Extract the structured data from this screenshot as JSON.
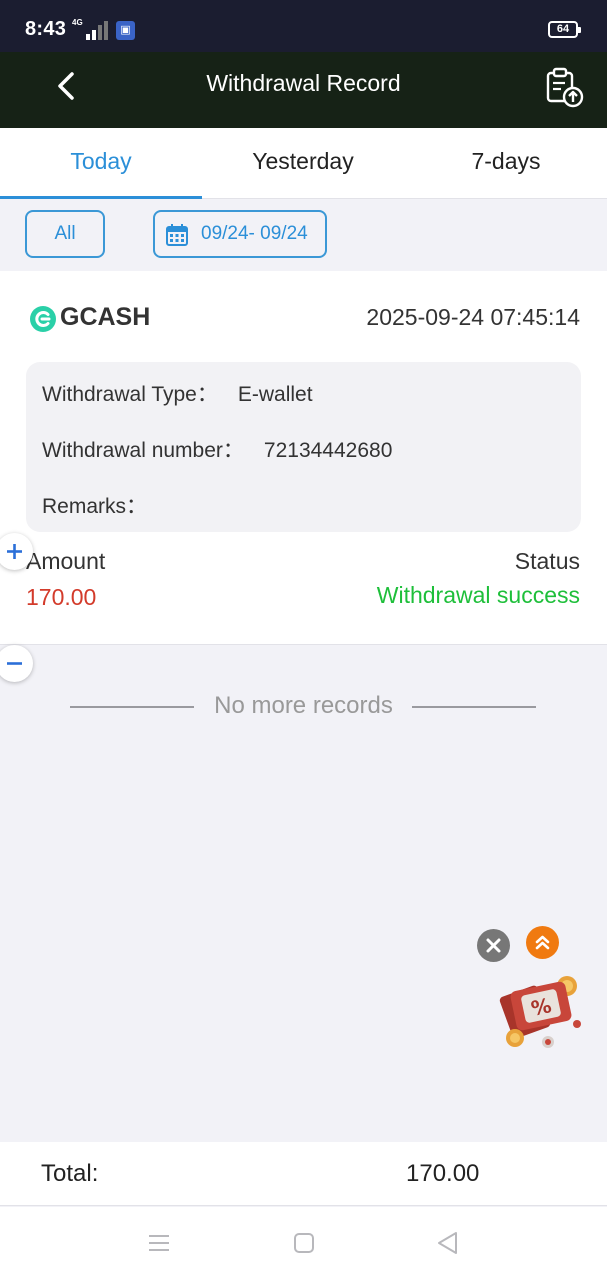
{
  "status_bar": {
    "time": "8:43",
    "network": "4G",
    "battery": "64"
  },
  "header": {
    "title": "Withdrawal Record",
    "back_icon": "chevron-left-icon",
    "export_icon": "clipboard-upload-icon"
  },
  "tabs": [
    {
      "label": "Today",
      "active": true
    },
    {
      "label": "Yesterday",
      "active": false
    },
    {
      "label": "7-days",
      "active": false
    }
  ],
  "filters": {
    "all_label": "All",
    "date_range": "09/24- 09/24",
    "date_icon": "calendar-icon"
  },
  "record": {
    "method": "GCASH",
    "method_icon": "gcash-logo-icon",
    "datetime": "2025-09-24 07:45:14",
    "type_label": "Withdrawal Type：",
    "type_value": "E-wallet",
    "number_label": "Withdrawal number：",
    "number_value": "72134442680",
    "remarks_label": "Remarks：",
    "remarks_value": "",
    "amount_label": "Amount",
    "amount_value": "170.00",
    "status_label": "Status",
    "status_value": "Withdrawal success"
  },
  "list_end_text": "No more records",
  "total": {
    "label": "Total:",
    "value": "170.00"
  },
  "colors": {
    "accent": "#2b8fd8",
    "header_bg": "#162216",
    "status_bar_bg": "#1b1d30",
    "amount": "#d33b2b",
    "success": "#1ebf3a",
    "scroll_top": "#f07a10"
  }
}
